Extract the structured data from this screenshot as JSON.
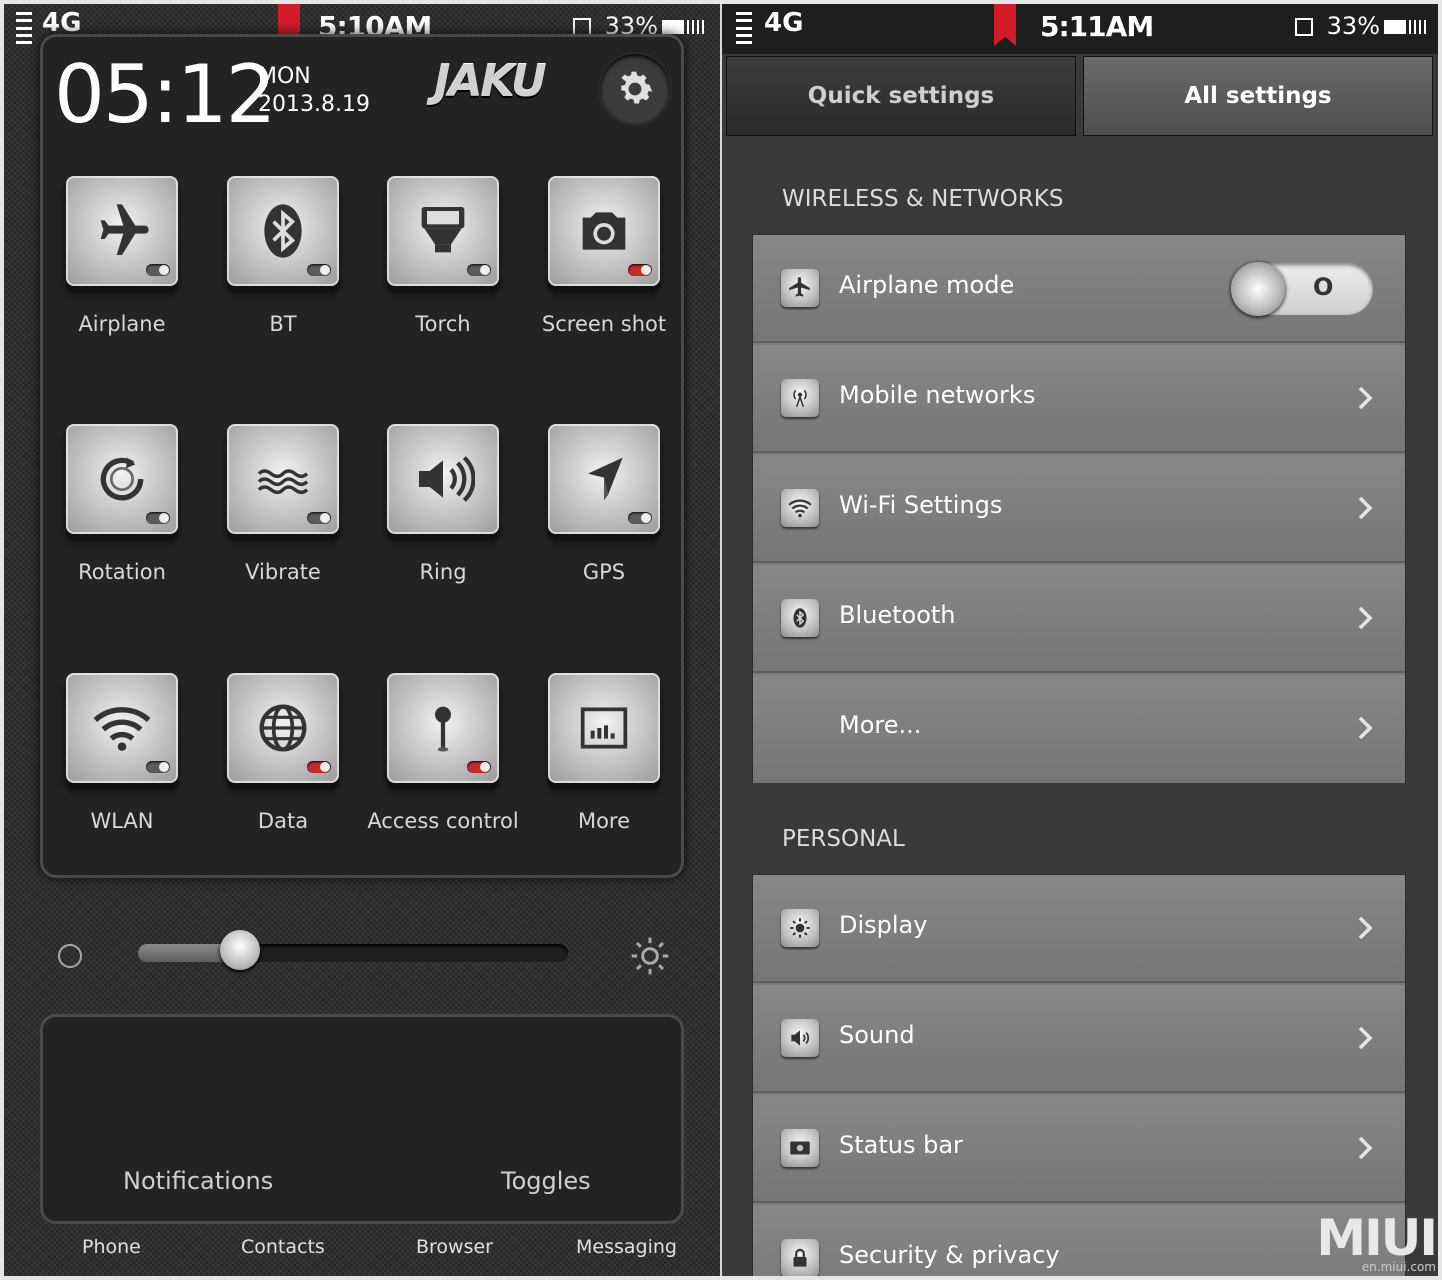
{
  "left": {
    "status": {
      "network": "4G",
      "time": "5:10AM",
      "battery": "33%"
    },
    "header": {
      "clock": "05:12",
      "day": "MON",
      "date": "2013.8.19",
      "brand": "JAKU"
    },
    "tiles": [
      {
        "label": "Airplane",
        "icon": "airplane-icon",
        "toggle": "off"
      },
      {
        "label": "BT",
        "icon": "bluetooth-icon",
        "toggle": "off"
      },
      {
        "label": "Torch",
        "icon": "torch-icon",
        "toggle": "off"
      },
      {
        "label": "Screen shot",
        "icon": "camera-icon",
        "toggle": "on"
      },
      {
        "label": "Rotation",
        "icon": "rotation-icon",
        "toggle": "off"
      },
      {
        "label": "Vibrate",
        "icon": "vibrate-icon",
        "toggle": "off"
      },
      {
        "label": "Ring",
        "icon": "speaker-icon",
        "toggle": "none"
      },
      {
        "label": "GPS",
        "icon": "gps-icon",
        "toggle": "off"
      },
      {
        "label": "WLAN",
        "icon": "wifi-icon",
        "toggle": "off"
      },
      {
        "label": "Data",
        "icon": "globe-icon",
        "toggle": "on"
      },
      {
        "label": "Access control",
        "icon": "pin-icon",
        "toggle": "on"
      },
      {
        "label": "More",
        "icon": "chart-icon",
        "toggle": "none"
      }
    ],
    "brightness": {
      "level": 0.2
    },
    "panel_tabs": {
      "notifications": "Notifications",
      "toggles": "Toggles"
    },
    "dock": [
      "Phone",
      "Contacts",
      "Browser",
      "Messaging"
    ]
  },
  "right": {
    "status": {
      "network": "4G",
      "time": "5:11AM",
      "battery": "33%"
    },
    "tabs": {
      "quick": "Quick settings",
      "all": "All settings"
    },
    "wireless": {
      "title": "WIRELESS & NETWORKS",
      "rows": [
        {
          "label": "Airplane mode",
          "icon": "airplane-icon",
          "control": "switch",
          "switch_text": "O"
        },
        {
          "label": "Mobile networks",
          "icon": "antenna-icon",
          "control": "chevron"
        },
        {
          "label": "Wi-Fi Settings",
          "icon": "wifi-icon",
          "control": "chevron"
        },
        {
          "label": "Bluetooth",
          "icon": "bluetooth-icon",
          "control": "chevron"
        },
        {
          "label": "More...",
          "icon": "",
          "control": "chevron"
        }
      ]
    },
    "personal": {
      "title": "PERSONAL",
      "rows": [
        {
          "label": "Display",
          "icon": "display-icon",
          "control": "chevron"
        },
        {
          "label": "Sound",
          "icon": "speaker-icon",
          "control": "chevron"
        },
        {
          "label": "Status bar",
          "icon": "statusbar-icon",
          "control": "chevron"
        },
        {
          "label": "Security & privacy",
          "icon": "lock-icon",
          "control": "chevron"
        }
      ]
    },
    "watermark": {
      "logo": "MIUI",
      "site": "en.miui.com"
    }
  },
  "colors": {
    "accent_red": "#d21c2a",
    "toggle_on": "#c62a2a"
  }
}
